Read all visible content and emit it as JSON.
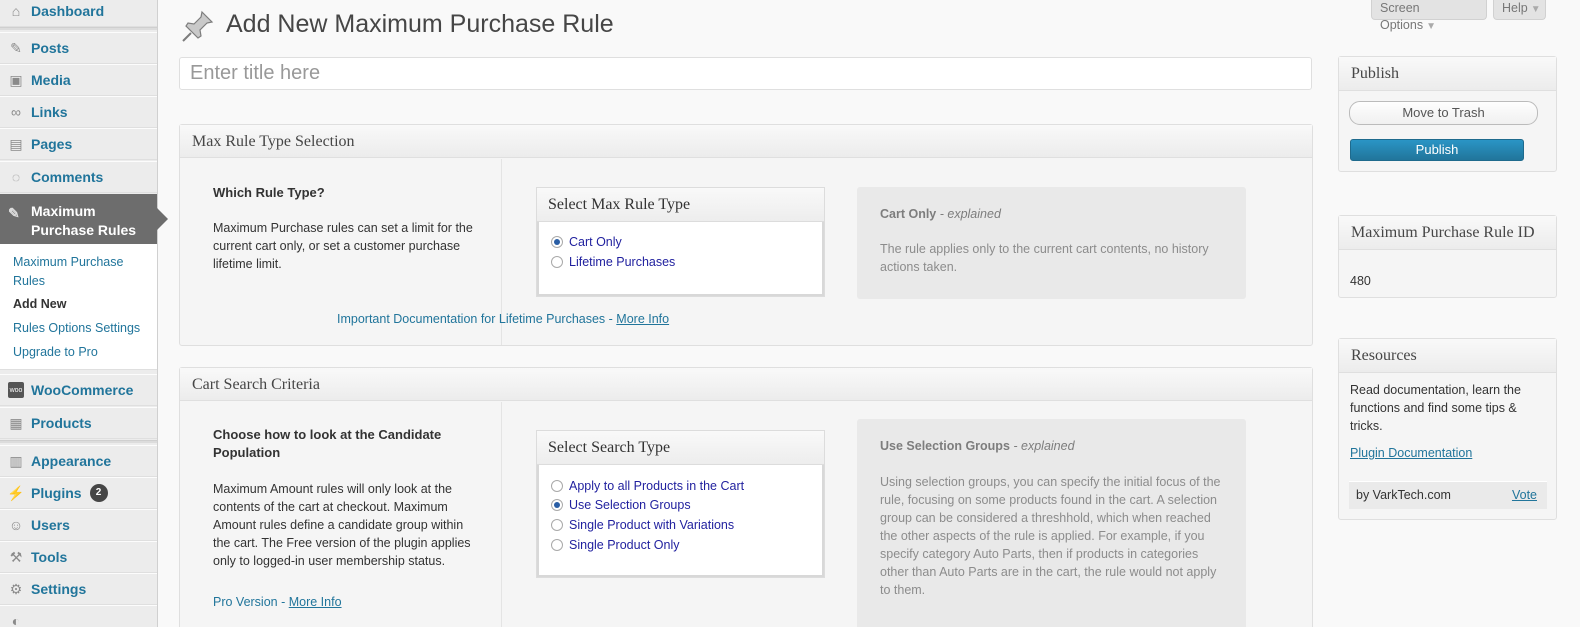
{
  "sidebar": {
    "items": [
      {
        "label": "Dashboard",
        "icon": "home-icon"
      },
      {
        "label": "Posts",
        "icon": "pin-icon"
      },
      {
        "label": "Media",
        "icon": "media-icon"
      },
      {
        "label": "Links",
        "icon": "link-icon"
      },
      {
        "label": "Pages",
        "icon": "page-icon"
      },
      {
        "label": "Comments",
        "icon": "comment-icon"
      },
      {
        "label": "Maximum Purchase Rules",
        "icon": "pin-icon"
      },
      {
        "label": "WooCommerce",
        "icon": "woo-icon"
      },
      {
        "label": "Products",
        "icon": "products-icon"
      },
      {
        "label": "Appearance",
        "icon": "appearance-icon"
      },
      {
        "label": "Plugins",
        "icon": "plugin-icon",
        "badge": "2"
      },
      {
        "label": "Users",
        "icon": "users-icon"
      },
      {
        "label": "Tools",
        "icon": "tools-icon"
      },
      {
        "label": "Settings",
        "icon": "settings-icon"
      }
    ],
    "submenu": [
      "Maximum Purchase Rules",
      "Add New",
      "Rules Options Settings",
      "Upgrade to Pro"
    ]
  },
  "header": {
    "title": "Add New Maximum Purchase Rule",
    "screen_options": "Screen Options",
    "help": "Help"
  },
  "title_input": {
    "placeholder": "Enter title here"
  },
  "rule_type_box": {
    "heading": "Max Rule Type Selection",
    "question": "Which Rule Type?",
    "description": "Maximum Purchase rules can set a limit for the current cart only, or set a customer purchase lifetime limit.",
    "select_heading": "Select Max Rule Type",
    "options": [
      "Cart Only",
      "Lifetime Purchases"
    ],
    "selected": "Cart Only",
    "explain_title": "Cart Only",
    "explain_suffix": " - explained",
    "explain_text": "The rule applies only to the current cart contents, no history actions taken.",
    "doc_text": "Important Documentation for Lifetime Purchases - ",
    "doc_link": "More Info"
  },
  "search_box": {
    "heading": "Cart Search Criteria",
    "question": "Choose how to look at the Candidate Population",
    "description": "Maximum Amount rules will only look at the contents of the cart at checkout. Maximum Amount rules define a candidate group within the cart. The Free version of the plugin applies only to logged-in user membership status.",
    "pro_text": "Pro Version - ",
    "pro_link": "More Info",
    "select_heading": "Select Search Type",
    "options": [
      "Apply to all Products in the Cart",
      "Use Selection Groups",
      "Single Product with Variations",
      "Single Product Only"
    ],
    "selected": "Use Selection Groups",
    "explain_title": "Use Selection Groups",
    "explain_suffix": " - explained",
    "explain_text": "Using selection groups, you can specify the initial focus of the rule, focusing on some products found in the cart. A selection group can be considered a threshhold, which when reached the other aspects of the rule is applied. For example, if you specify category Auto Parts, then if products in categories other than Auto Parts are in the cart, the rule would not apply to them."
  },
  "publish_box": {
    "heading": "Publish",
    "trash_label": "Move to Trash",
    "publish_label": "Publish"
  },
  "rule_id_box": {
    "heading": "Maximum Purchase Rule ID",
    "value": "480"
  },
  "resources_box": {
    "heading": "Resources",
    "text": "Read documentation, learn the functions and find some tips & tricks.",
    "doc_link": "Plugin Documentation",
    "credit": "by VarkTech.com",
    "vote": "Vote"
  },
  "colors": {
    "accent": "#21759b",
    "active_menu": "#6d6d6d",
    "radio_text": "#1f1f9e"
  }
}
